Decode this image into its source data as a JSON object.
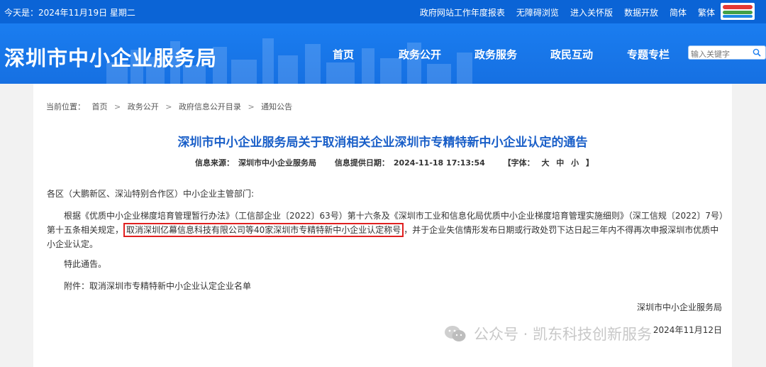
{
  "topbar": {
    "date": "今天是：2024年11月19日 星期二",
    "links": [
      "政府网站工作年度报表",
      "无障碍浏览",
      "进入关怀版",
      "数据开放",
      "简体",
      "繁体"
    ]
  },
  "header": {
    "site_title": "深圳市中小企业服务局",
    "nav": [
      "首页",
      "政务公开",
      "政务服务",
      "政民互动",
      "专题专栏"
    ],
    "active_nav": "政务公开",
    "search_placeholder": "输入关键字"
  },
  "breadcrumb": {
    "label": "当前位置：",
    "items": [
      "首页",
      "政务公开",
      "政府信息公开目录",
      "通知公告"
    ]
  },
  "article": {
    "title": "深圳市中小企业服务局关于取消相关企业深圳市专精特新中小企业认定的通告",
    "meta": {
      "source_label": "信息来源：",
      "source": "深圳市中小企业服务局",
      "date_label": "信息提供日期：",
      "date": "2024-11-18 17:13:54",
      "font_label": "【字体：",
      "font_sizes": [
        "大",
        "中",
        "小"
      ],
      "font_end": "】"
    },
    "greeting": "各区（大鹏新区、深汕特别合作区）中小企业主管部门:",
    "body_pre": "根据《优质中小企业梯度培育管理暂行办法》（工信部企业〔2022〕63号）第十六条及《深圳市工业和信息化局优质中小企业梯度培育管理实施细则》（深工信规〔2022〕7号）第十五条相关规定，",
    "body_highlight": "取消深圳亿幕信息科技有限公司等40家深圳市专精特新中小企业认定称号",
    "body_post": "，并于企业失信情形发布日期或行政处罚下达日起三年内不得再次申报深圳市优质中小企业认定。",
    "notice": "特此通告。",
    "attachment_label": "附件：",
    "attachment": "取消深圳市专精特新中小企业认定企业名单",
    "signature": "深圳市中小企业服务局",
    "sign_date": "2024年11月12日"
  },
  "watermark": "公众号 · 凯东科技创新服务",
  "colors": {
    "topbar": "#0b64d6",
    "header": "#1a7df0",
    "title": "#1a5fc8",
    "highlight": "#e02020"
  }
}
